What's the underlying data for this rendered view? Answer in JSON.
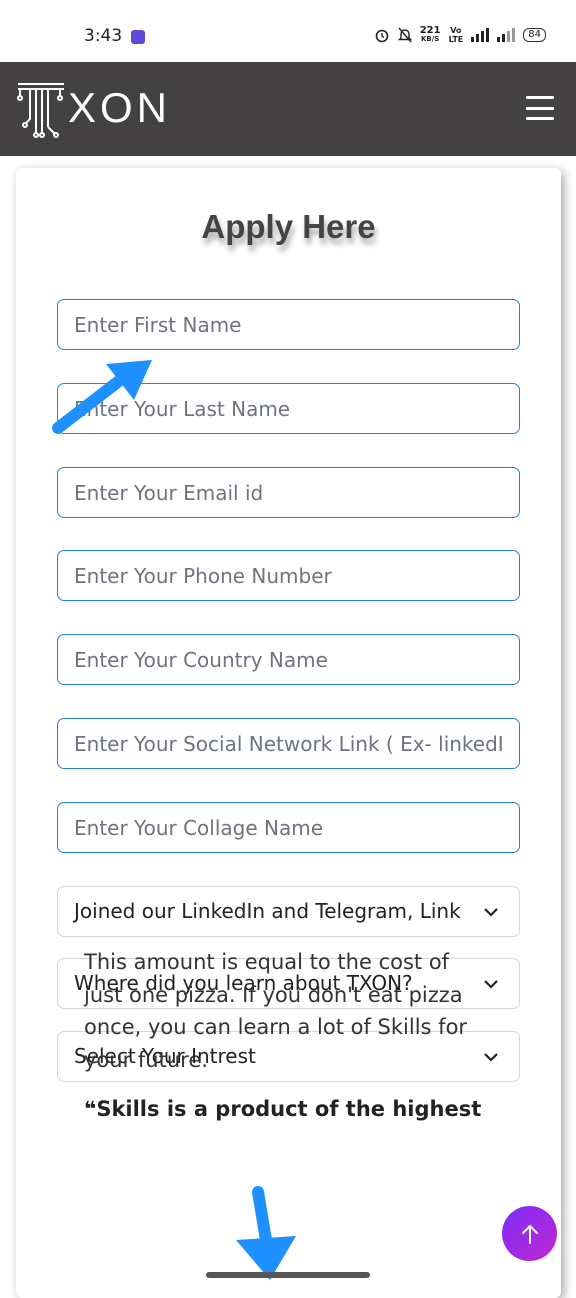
{
  "status": {
    "time": "3:43",
    "net_speed": "221",
    "net_unit": "KB/S",
    "battery": "84"
  },
  "header": {
    "brand": "XON"
  },
  "form": {
    "title": "Apply Here",
    "fields": {
      "first_name": "Enter First Name",
      "last_name": "Enter Your Last Name",
      "email": "Enter Your Email id",
      "phone": "Enter Your Phone Number",
      "country": "Enter Your Country Name",
      "social": "Enter Your Social Network Link ( Ex- linkedIn )",
      "college": "Enter Your Collage Name"
    },
    "selects": {
      "joined": "Joined our LinkedIn and Telegram, Link",
      "source": "Where did you learn about TXON?",
      "interest": "Select Your Intrest"
    }
  },
  "promo": {
    "text": "This amount is equal to the cost of just one pizza. If you don't eat pizza once, you can learn a lot of Skills for your future.",
    "text2": "❝Skills is a product of the highest"
  },
  "colors": {
    "navbar": "#434142",
    "field_border": "#2b7fd6",
    "arrow": "#1e90ff",
    "scroll_button": "#9b2ee8"
  }
}
